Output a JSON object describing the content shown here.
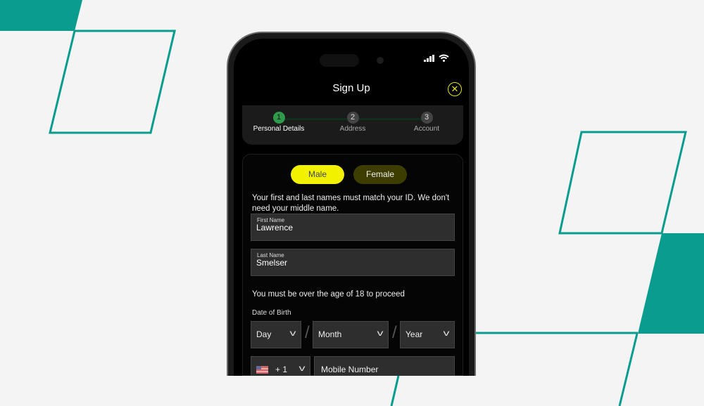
{
  "colors": {
    "teal": "#0a9c8e",
    "accent": "#f2f200",
    "step_active": "#2e9a4a"
  },
  "header": {
    "title": "Sign Up",
    "close_icon": "close-icon"
  },
  "stepper": {
    "steps": [
      {
        "number": "1",
        "label": "Personal Details",
        "active": true
      },
      {
        "number": "2",
        "label": "Address",
        "active": false
      },
      {
        "number": "3",
        "label": "Account",
        "active": false
      }
    ]
  },
  "gender": {
    "male": "Male",
    "female": "Female",
    "selected": "Male"
  },
  "form": {
    "name_info": "Your first and last names must match your ID. We don't need your middle name.",
    "first_name": {
      "label": "First Name",
      "value": "Lawrence"
    },
    "last_name": {
      "label": "Last Name",
      "value": "Smelser"
    },
    "age_notice": "You must be over the age of 18 to proceed",
    "dob_label": "Date of Birth",
    "day": "Day",
    "month": "Month",
    "year": "Year",
    "separator": "/",
    "country_code": "+ 1",
    "mobile_placeholder": "Mobile Number"
  }
}
